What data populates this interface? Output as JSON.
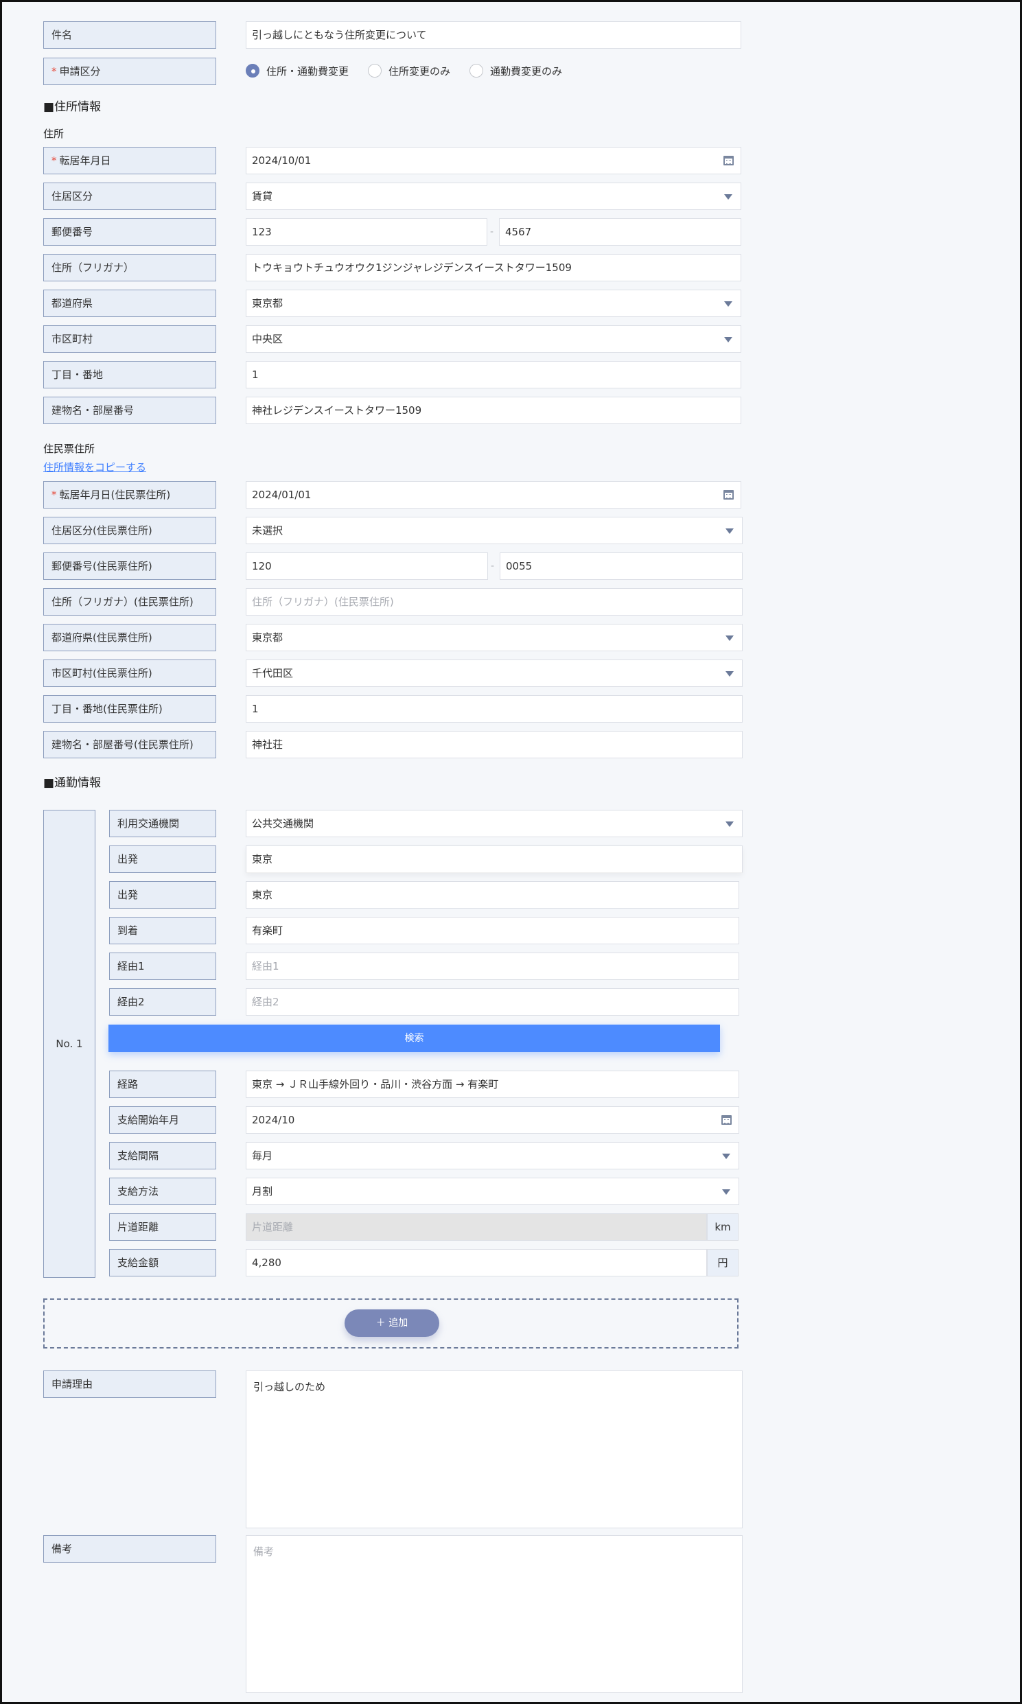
{
  "basic": {
    "subject_label": "件名",
    "subject_value": "引っ越しにともなう住所変更について",
    "category_label": "申請区分",
    "required_mark": "*",
    "category_options": [
      "住所・通勤費変更",
      "住所変更のみ",
      "通勤費変更のみ"
    ],
    "category_selected": "住所・通勤費変更"
  },
  "address_section": {
    "heading": "■住所情報",
    "address_subheading": "住所",
    "move_date_label": "転居年月日",
    "move_date_value": "2024/10/01",
    "housing_type_label": "住居区分",
    "housing_type_value": "賃貸",
    "postal_label": "郵便番号",
    "postal_1": "123",
    "postal_2": "4567",
    "postal_separator": "-",
    "kana_label": "住所（フリガナ）",
    "kana_value": "トウキョウトチュウオウク1ジンジャレジデンスイーストタワー1509",
    "prefecture_label": "都道府県",
    "prefecture_value": "東京都",
    "city_label": "市区町村",
    "city_value": "中央区",
    "street_label": "丁目・番地",
    "street_value": "1",
    "building_label": "建物名・部屋番号",
    "building_value": "神社レジデンスイーストタワー1509"
  },
  "resident_section": {
    "subheading": "住民票住所",
    "copy_link": "住所情報をコピーする",
    "move_date_label": "転居年月日(住民票住所)",
    "move_date_value": "2024/01/01",
    "housing_type_label": "住居区分(住民票住所)",
    "housing_type_value": "未選択",
    "postal_label": "郵便番号(住民票住所)",
    "postal_1": "120",
    "postal_2": "0055",
    "postal_separator": "-",
    "kana_label": "住所（フリガナ）(住民票住所)",
    "kana_placeholder": "住所（フリガナ）(住民票住所)",
    "prefecture_label": "都道府県(住民票住所)",
    "prefecture_value": "東京都",
    "city_label": "市区町村(住民票住所)",
    "city_value": "千代田区",
    "street_label": "丁目・番地(住民票住所)",
    "street_value": "1",
    "building_label": "建物名・部屋番号(住民票住所)",
    "building_value": "神社荘"
  },
  "commute_section": {
    "heading": "■通勤情報",
    "entry_no": "No. 1",
    "transport_label": "利用交通機関",
    "transport_value": "公共交通機関",
    "departure_label_1": "出発",
    "departure_value_1": "東京",
    "departure_label_2": "出発",
    "departure_value_2": "東京",
    "arrival_label": "到着",
    "arrival_value": "有楽町",
    "via1_label": "経由1",
    "via1_placeholder": "経由1",
    "via2_label": "経由2",
    "via2_placeholder": "経由2",
    "search_button": "検索",
    "route_label": "経路",
    "route_value": "東京 → ＪＲ山手線外回り・品川・渋谷方面 → 有楽町",
    "start_month_label": "支給開始年月",
    "start_month_value": "2024/10",
    "interval_label": "支給間隔",
    "interval_value": "毎月",
    "method_label": "支給方法",
    "method_value": "月割",
    "distance_label": "片道距離",
    "distance_placeholder": "片道距離",
    "distance_unit": "km",
    "amount_label": "支給金額",
    "amount_value": "4,280",
    "amount_unit": "円",
    "add_button": "＋ 追加"
  },
  "footer_fields": {
    "reason_label": "申請理由",
    "reason_value": "引っ越しのため",
    "remarks_label": "備考",
    "remarks_placeholder": "備考"
  },
  "colors": {
    "accent_blue": "#4d8bff",
    "label_bg": "#e8eef7",
    "label_border": "#8c9dbd",
    "required_red": "#e64a3b",
    "add_button": "#7b88b8",
    "link": "#3f7fff"
  }
}
